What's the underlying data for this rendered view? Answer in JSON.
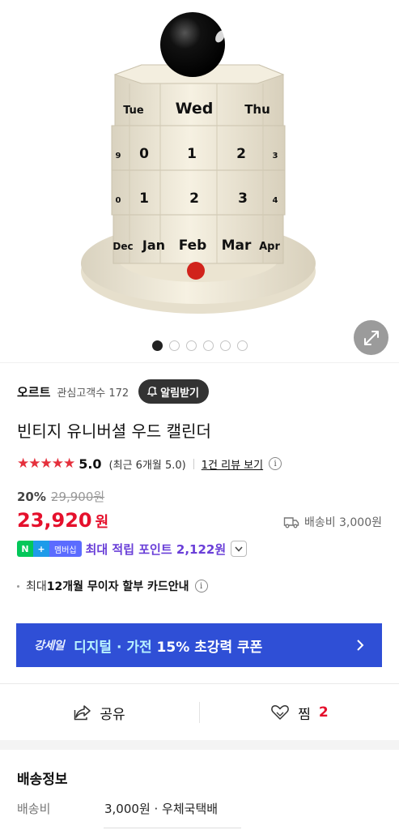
{
  "gallery": {
    "calendar_rows": [
      [
        "Tue",
        "Wed",
        "Thu"
      ],
      [
        "9",
        "0",
        "1",
        "2",
        "3"
      ],
      [
        "0",
        "1",
        "2",
        "3",
        "4"
      ],
      [
        "Dec",
        "Jan",
        "Feb",
        "Mar",
        "Apr"
      ]
    ],
    "slide_count": 6,
    "active_slide": 0
  },
  "seller": {
    "name": "오르트",
    "interest": "관심고객수 172",
    "alarm_label": "알림받기"
  },
  "product": {
    "title": "빈티지 유니버셜 우드 캘린더"
  },
  "rating": {
    "stars": "★★★★★",
    "score": "5.0",
    "recent": "(최근 6개월 5.0)",
    "review_link": "1건 리뷰 보기",
    "info": "i"
  },
  "pricing": {
    "discount_rate": "20%",
    "original_price": "29,900원",
    "price": "23,920",
    "won": "원",
    "shipping_fee": "배송비 3,000원"
  },
  "points": {
    "badge_n": "N",
    "badge_plus": "+",
    "badge_member": "멤버십",
    "text": "최대 적립 포인트 2,122원"
  },
  "installment": {
    "prefix": "최대 ",
    "bold": "12개월 무이자 할부 카드안내",
    "info": "i"
  },
  "coupon": {
    "brand": "강세일",
    "text_highlight": "디지털 · 가전",
    "text_rest": " 15% 초강력 쿠폰"
  },
  "actions": {
    "share_label": "공유",
    "zzim_label": "찜",
    "zzim_count": "2"
  },
  "shipping_info": {
    "title": "배송정보",
    "fee_label": "배송비",
    "fee_value": "3,000원 · 우체국택배"
  },
  "colors": {
    "price_red": "#e5102c",
    "coupon_blue": "#2f4fd6",
    "points_purple": "#6a3fd8",
    "npay_green": "#03c75a"
  }
}
